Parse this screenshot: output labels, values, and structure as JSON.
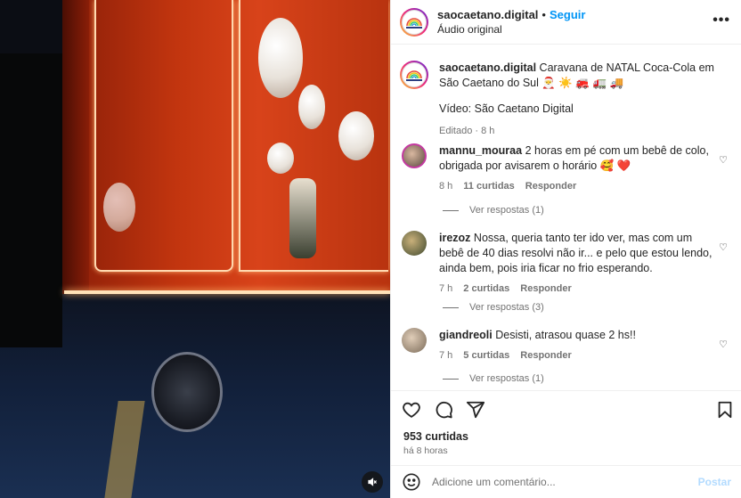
{
  "post": {
    "username": "saocaetano.digital",
    "follow_label": "Seguir",
    "audio": "Áudio original",
    "more_icon": "more-horizontal-icon",
    "caption_username": "saocaetano.digital",
    "caption_text": "Caravana de NATAL Coca-Cola em São Caetano do Sul 🎅 ☀️ 🚒 🚛 🚚",
    "caption_credit": "Vídeo: São Caetano Digital",
    "caption_meta": "Editado · 8 h"
  },
  "comments": [
    {
      "username": "mannu_mouraa",
      "text": "2 horas em pé com um bebê de colo, obrigada por avisarem o horário 🥰 ❤️",
      "time": "8 h",
      "likes": "11 curtidas",
      "reply": "Responder",
      "view_replies": "Ver respostas (1)",
      "avatar_color": "#5a4a3f"
    },
    {
      "username": "irezoz",
      "text": "Nossa, queria tanto ter ido ver, mas com um bebê de 40 dias resolvi não ir... e pelo que estou lendo, ainda bem, pois iria ficar no frio esperando.",
      "time": "7 h",
      "likes": "2 curtidas",
      "reply": "Responder",
      "view_replies": "Ver respostas (3)",
      "avatar_color": "#6d7a5a"
    },
    {
      "username": "giandreoli",
      "text": "Desisti, atrasou quase 2 hs!!",
      "time": "7 h",
      "likes": "5 curtidas",
      "reply": "Responder",
      "view_replies": "Ver respostas (1)",
      "avatar_color": "#a08c78"
    }
  ],
  "actions": {
    "likes": "953 curtidas",
    "time_ago": "há 8 horas"
  },
  "comment_box": {
    "placeholder": "Adicione um comentário...",
    "post_label": "Postar"
  },
  "colors": {
    "accent": "#0095f6",
    "post_disabled": "#b3dbff"
  }
}
